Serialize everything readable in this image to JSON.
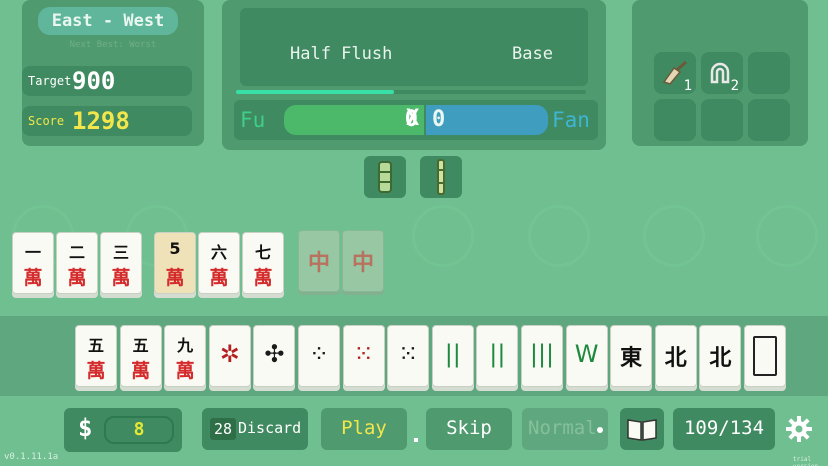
{
  "round": {
    "wind_label": "East - West",
    "next_label": "Next Best: Worst"
  },
  "stats": {
    "target_label": "Target",
    "target_value": "900",
    "score_label": "Score",
    "score_value": "1298"
  },
  "score_display": {
    "hand_name": "Half Flush",
    "base_label": "Base",
    "progress": 0.45,
    "fu_label": "Fu",
    "fu_value": "0",
    "times": "X",
    "fan_value": "0",
    "fan_label": "Fan"
  },
  "items": [
    {
      "icon": "broom-icon",
      "count": "1"
    },
    {
      "icon": "magnet-icon",
      "count": "2"
    }
  ],
  "tools": [
    "bamboo-tube-icon",
    "bamboo-stick-icon"
  ],
  "played_tiles": [
    {
      "top": "一",
      "bottom": "萬"
    },
    {
      "top": "二",
      "bottom": "萬"
    },
    {
      "top": "三",
      "bottom": "萬"
    },
    {
      "top": "5",
      "bottom": "萬",
      "special": "gold"
    },
    {
      "top": "六",
      "bottom": "萬"
    },
    {
      "top": "七",
      "bottom": "萬"
    }
  ],
  "ghost_tiles": [
    "中",
    "中"
  ],
  "hand_tiles": [
    {
      "kind": "wan",
      "top": "五",
      "bottom": "萬"
    },
    {
      "kind": "wan",
      "top": "五",
      "bottom": "萬"
    },
    {
      "kind": "wan",
      "top": "九",
      "bottom": "萬"
    },
    {
      "kind": "glyph",
      "icon": "pinwheel-icon",
      "glyph": "✲",
      "color": "#b52020"
    },
    {
      "kind": "glyph",
      "icon": "dots-icon",
      "glyph": "✣",
      "color": "#1a1a1a"
    },
    {
      "kind": "glyph",
      "icon": "dots-icon",
      "glyph": "⁘",
      "color": "#1a1a1a"
    },
    {
      "kind": "glyph",
      "icon": "dots-icon",
      "glyph": "⁙",
      "color": "#b52020"
    },
    {
      "kind": "glyph",
      "icon": "dots-icon",
      "glyph": "⁙",
      "color": "#1a1a1a"
    },
    {
      "kind": "glyph",
      "icon": "bamboo-icon",
      "glyph": "||",
      "color": "#1e8a40"
    },
    {
      "kind": "glyph",
      "icon": "bamboo-icon",
      "glyph": "||",
      "color": "#1e8a40"
    },
    {
      "kind": "glyph",
      "icon": "bamboo-icon",
      "glyph": "|||",
      "color": "#1e8a40"
    },
    {
      "kind": "glyph",
      "icon": "bamboo-icon",
      "glyph": "W",
      "color": "#1e8a40"
    },
    {
      "kind": "honor",
      "text": "東"
    },
    {
      "kind": "honor",
      "text": "北"
    },
    {
      "kind": "honor",
      "text": "北"
    },
    {
      "kind": "blank"
    }
  ],
  "bottom_bar": {
    "money_sign": "$",
    "money_value": "8",
    "discard_count": "28",
    "discard_label": "Discard",
    "play_label": "Play",
    "skip_label": "Skip",
    "mode_label": "Normal",
    "wall_count": "109/134"
  },
  "version": "v0.1.11.1a",
  "watermark": "trial version",
  "colors": {
    "background": "#6fbf90",
    "panel": "#4f9a6f",
    "score_yellow": "#f2e64a",
    "target_white": "#ffffff",
    "fu_green": "#3ecf8a",
    "fan_blue": "#3fb5d6",
    "wan_red": "#d42c2c"
  }
}
